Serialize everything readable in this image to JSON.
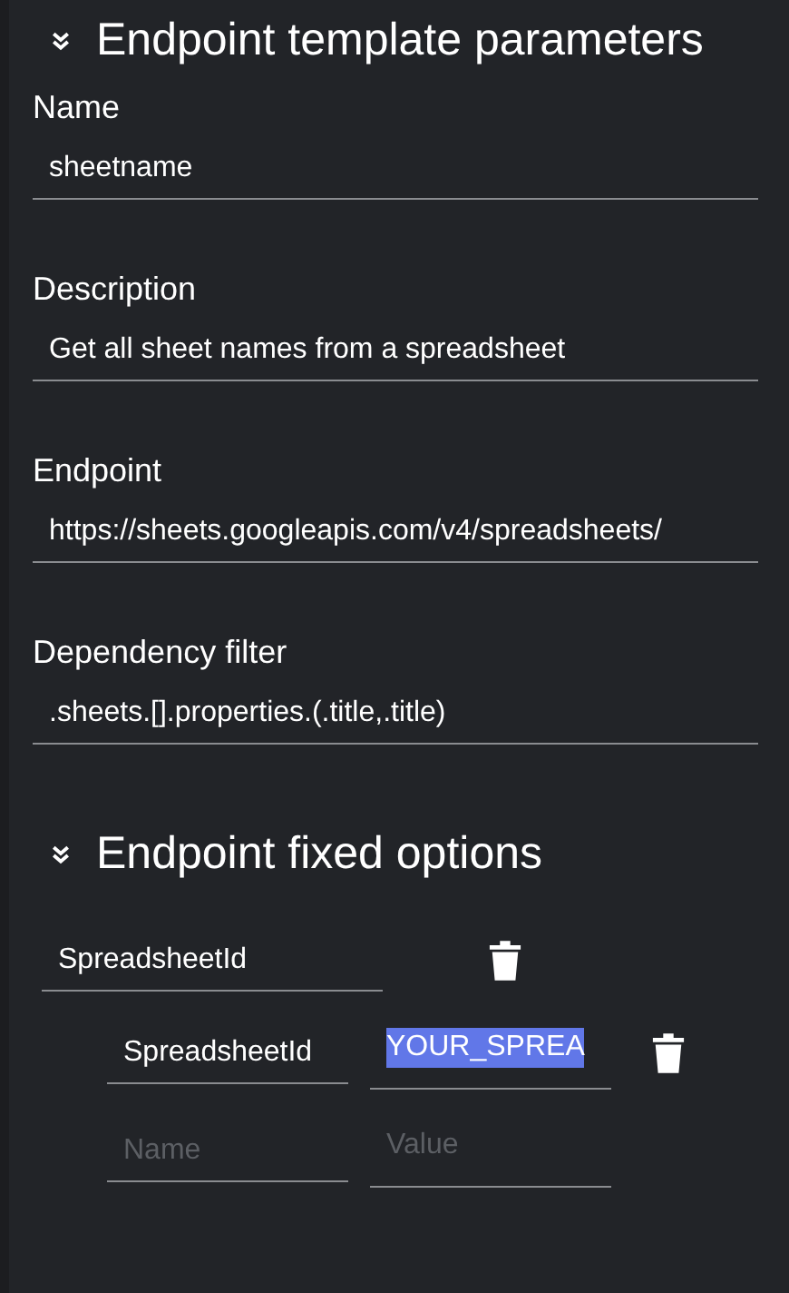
{
  "template_section": {
    "title": "Endpoint template parameters",
    "expanded": true,
    "fields": [
      {
        "label": "Name",
        "value": "sheetname"
      },
      {
        "label": "Description",
        "value": "Get all sheet names from a spreadsheet"
      },
      {
        "label": "Endpoint",
        "value": "https://sheets.googleapis.com/v4/spreadsheets/"
      },
      {
        "label": "Dependency filter",
        "value": ".sheets.[].properties.(.title,.title)"
      }
    ]
  },
  "options_section": {
    "title": "Endpoint fixed options",
    "expanded": true,
    "options": [
      {
        "name": "SpreadsheetId",
        "params": [
          {
            "name": "SpreadsheetId",
            "value": "YOUR_SPREA",
            "selected": true
          }
        ],
        "new_param": {
          "name_placeholder": "Name",
          "value_placeholder": "Value"
        }
      }
    ]
  }
}
